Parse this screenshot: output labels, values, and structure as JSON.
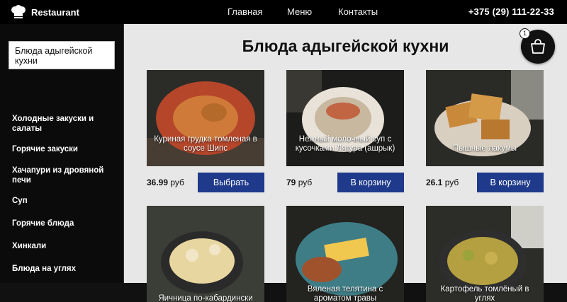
{
  "header": {
    "logo_text": "Restaurant",
    "nav": [
      "Главная",
      "Меню",
      "Контакты"
    ],
    "phone": "+375 (29) 111-22-33"
  },
  "sidebar": {
    "current": "Блюда адыгейской кухни",
    "items": [
      "Холодные закуски и салаты",
      "Горячие закуски",
      "Хачапури из дровяной печи",
      "Суп",
      "Горячие блюда",
      "Хинкали",
      "Блюда на углях"
    ]
  },
  "main": {
    "title": "Блюда адыгейской кухни",
    "cart_count": "1",
    "products": [
      {
        "name": "Куриная грудка томленая в соусе Шипс",
        "price": "36.99",
        "currency": "руб",
        "button": "Выбрать",
        "plate": "#b5462a",
        "food": "#d07a3a"
      },
      {
        "name": "Нежный молочный суп с кусочками Лягура (ашрык)",
        "price": "79",
        "currency": "руб",
        "button": "В корзину",
        "plate": "#e8e2d8",
        "food": "#c8b8a0"
      },
      {
        "name": "Пышные лакумы",
        "price": "26.1",
        "currency": "руб",
        "button": "В корзину",
        "plate": "#d9cfc0",
        "food": "#c8893a"
      },
      {
        "name": "Яичница по-кабардински",
        "price": "",
        "currency": "",
        "button": "",
        "plate": "#2a2a2a",
        "food": "#e8d6a0"
      },
      {
        "name": "Вяленая телятина с ароматом травы",
        "price": "",
        "currency": "",
        "button": "",
        "plate": "#3e7d86",
        "food": "#a0522d"
      },
      {
        "name": "Картофель томлёный в углях",
        "price": "",
        "currency": "",
        "button": "",
        "plate": "#2e2e2e",
        "food": "#b4a040"
      }
    ]
  }
}
